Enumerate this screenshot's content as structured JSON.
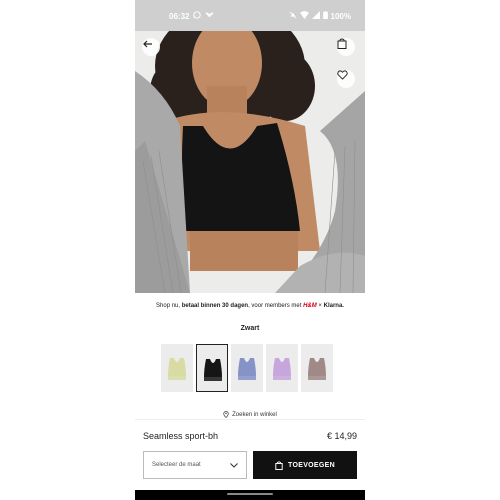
{
  "status_bar": {
    "time": "06:32",
    "battery": "100%",
    "left_icons": [
      "whatsapp-icon",
      "cast-icon"
    ],
    "right_icons": [
      "mute-icon",
      "wifi-icon",
      "signal-icon",
      "battery-icon"
    ]
  },
  "gallery": {
    "image_count": 5,
    "active_index": 0
  },
  "promo": {
    "prefix": "Shop nu, ",
    "bold": "betaal binnen 30 dagen",
    "suffix": ", voor members met ",
    "brand": "H&M",
    "cross": " × ",
    "partner": "Klarna."
  },
  "color": {
    "selected_name": "Zwart",
    "swatches": [
      {
        "color": "#d8dca4",
        "selected": false
      },
      {
        "color": "#151515",
        "selected": true
      },
      {
        "color": "#8593c7",
        "selected": false
      },
      {
        "color": "#c7a6dc",
        "selected": false
      },
      {
        "color": "#9f8a87",
        "selected": false
      }
    ]
  },
  "store_link": "Zoeken in winkel",
  "product": {
    "name": "Seamless sport-bh",
    "price": "€ 14,99"
  },
  "size_select": {
    "placeholder": "Selecteer de maat"
  },
  "add_button": {
    "label": "TOEVOEGEN"
  }
}
